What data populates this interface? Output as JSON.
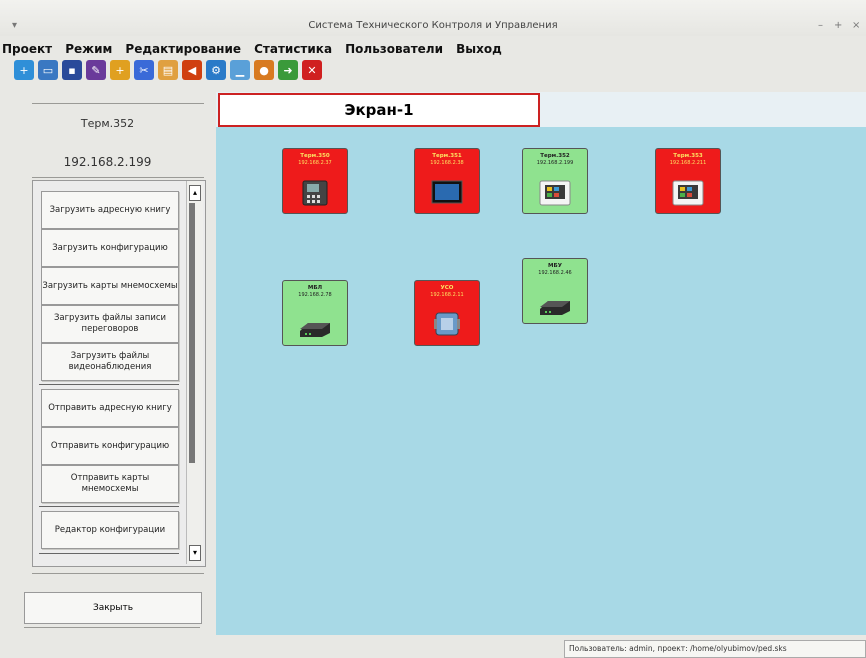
{
  "window": {
    "title": "Система Технического Контроля и Управления",
    "controls": [
      "–",
      "+",
      "×"
    ]
  },
  "menu": [
    "Проект",
    "Режим",
    "Редактирование",
    "Статистика",
    "Пользователи",
    "Выход"
  ],
  "toolbar": [
    {
      "icon": "new-file-icon",
      "color": "#2f8fd8"
    },
    {
      "icon": "open-folder-icon",
      "color": "#3a78c2"
    },
    {
      "icon": "save-icon",
      "color": "#2a4a9a"
    },
    {
      "icon": "save-as-icon",
      "color": "#6a3a9a"
    },
    {
      "icon": "new-screen-icon",
      "color": "#e0a020"
    },
    {
      "icon": "cut-icon",
      "color": "#3a6ad8"
    },
    {
      "icon": "paste-icon",
      "color": "#e0a040"
    },
    {
      "icon": "sound-icon",
      "color": "#d04010"
    },
    {
      "icon": "settings-icon",
      "color": "#2a7ac8"
    },
    {
      "icon": "chart-icon",
      "color": "#5aa0d8"
    },
    {
      "icon": "users-icon",
      "color": "#d87a20"
    },
    {
      "icon": "import-icon",
      "color": "#3a9a3a"
    },
    {
      "icon": "exit-icon",
      "color": "#d02020"
    }
  ],
  "left": {
    "terminal": "Терм.352",
    "ip": "192.168.2.199",
    "buttons": [
      "Загрузить адресную книгу",
      "Загрузить конфигурацию",
      "Загрузить карты мнемосхемы",
      "Загрузить файлы записи переговоров",
      "Загрузить файлы видеонаблюдения",
      "Отправить адресную книгу",
      "Отправить конфигурацию",
      "Отправить карты мнемосхемы",
      "Редактор конфигурации"
    ],
    "close": "Закрыть"
  },
  "screen_tab": "Экран-1",
  "devices": [
    {
      "name": "Терм.350",
      "ip": "192.168.2.37",
      "status": "red",
      "icon": "desk-phone-icon"
    },
    {
      "name": "Терм.351",
      "ip": "192.168.2.38",
      "status": "red",
      "icon": "monitor-icon"
    },
    {
      "name": "Терм.352",
      "ip": "192.168.2.199",
      "status": "green",
      "icon": "terminal-screen-icon"
    },
    {
      "name": "Терм.353",
      "ip": "192.168.2.211",
      "status": "red",
      "icon": "terminal-screen-icon"
    },
    {
      "name": "МБЛ",
      "ip": "192.168.2.78",
      "status": "green",
      "icon": "network-box-icon"
    },
    {
      "name": "УСО",
      "ip": "192.168.2.11",
      "status": "red",
      "icon": "io-module-icon"
    },
    {
      "name": "МБУ",
      "ip": "192.168.2.46",
      "status": "green",
      "icon": "network-box-icon"
    }
  ],
  "status": "Пользователь: admin, проект: /home/olyubimov/ped.sks"
}
